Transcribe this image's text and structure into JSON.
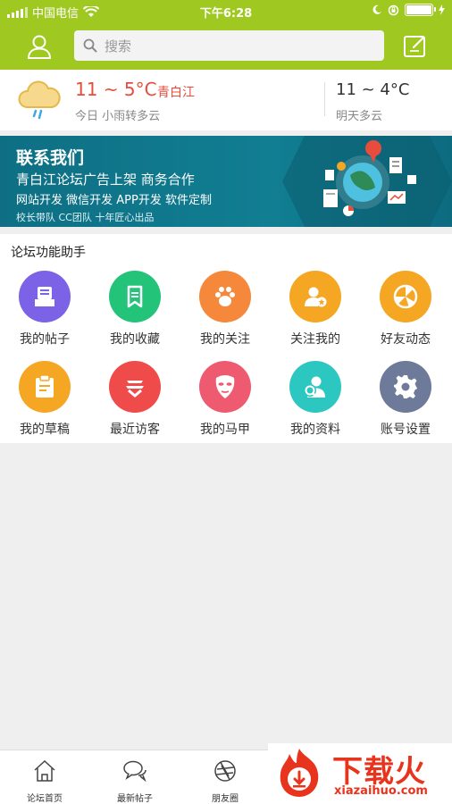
{
  "status_bar": {
    "carrier": "中国电信",
    "time": "下午6:28"
  },
  "header": {
    "search_placeholder": "搜索"
  },
  "weather": {
    "today_temp": "11 ~ 5°C",
    "city": "青白江",
    "today_desc": "今日 小雨转多云",
    "tomorrow_temp": "11 ~ 4°C",
    "tomorrow_desc": "明天多云"
  },
  "banner": {
    "title": "联系我们",
    "line2": "青白江论坛广告上架 商务合作",
    "line3": "网站开发 微信开发 APP开发 软件定制",
    "line4": "校长带队 CC团队 十年匠心出品"
  },
  "functions": {
    "title": "论坛功能助手",
    "items": [
      {
        "label": "我的帖子",
        "color": "#7b62e6",
        "icon": "post-icon"
      },
      {
        "label": "我的收藏",
        "color": "#23c47a",
        "icon": "bookmark-icon"
      },
      {
        "label": "我的关注",
        "color": "#f5883a",
        "icon": "paw-icon"
      },
      {
        "label": "关注我的",
        "color": "#f5a623",
        "icon": "follower-icon"
      },
      {
        "label": "好友动态",
        "color": "#f5a623",
        "icon": "friends-feed-icon"
      },
      {
        "label": "我的草稿",
        "color": "#f5a623",
        "icon": "draft-icon"
      },
      {
        "label": "最近访客",
        "color": "#ef4b4b",
        "icon": "visitor-icon"
      },
      {
        "label": "我的马甲",
        "color": "#ee5a6f",
        "icon": "mask-icon"
      },
      {
        "label": "我的资料",
        "color": "#2cc7c0",
        "icon": "profile-icon"
      },
      {
        "label": "账号设置",
        "color": "#6d7a99",
        "icon": "gear-icon"
      }
    ]
  },
  "tabbar": {
    "tabs": [
      {
        "label": "论坛首页"
      },
      {
        "label": "最新帖子"
      },
      {
        "label": "朋友圈"
      }
    ]
  },
  "watermark": {
    "text": "下载火",
    "url": "xiazaihuo.com"
  }
}
